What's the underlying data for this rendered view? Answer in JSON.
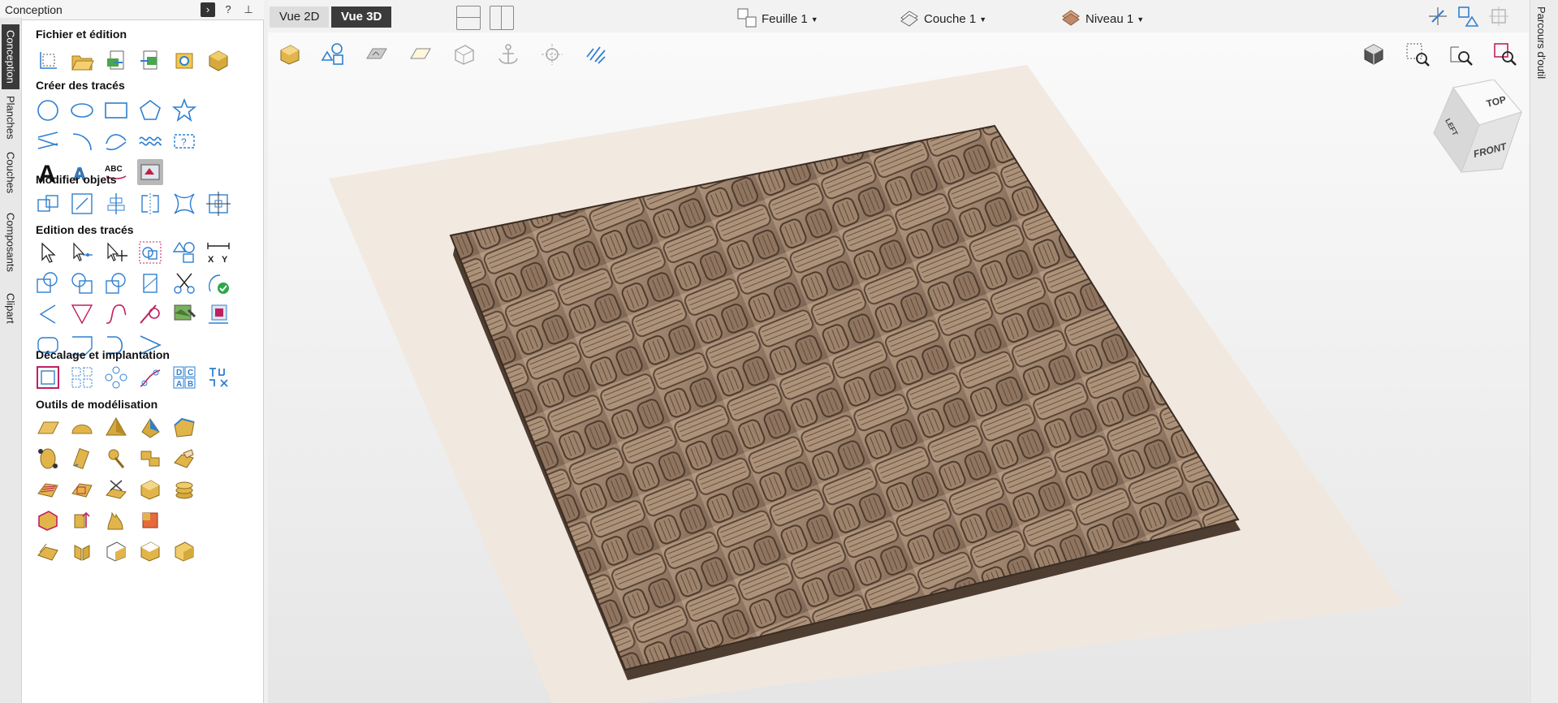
{
  "panel": {
    "title": "Conception",
    "help": "?",
    "pin": "⊥"
  },
  "side_tabs": [
    "Conception",
    "Planches",
    "Couches",
    "Composants",
    "Clipart"
  ],
  "sections": {
    "file": "Fichier et édition",
    "create": "Créer des tracés",
    "modify": "Modifier objets",
    "edit": "Edition des tracés",
    "offset": "Décalage et implantation",
    "modeling": "Outils de modélisation"
  },
  "create_text_glyphs": {
    "big_a": "A",
    "abc": "ABC"
  },
  "edit_xy": {
    "x": "X",
    "y": "Y"
  },
  "offset_labels": {
    "a": "A",
    "b": "B",
    "c": "C",
    "d": "D"
  },
  "toolbar": {
    "vue2d": "Vue 2D",
    "vue3d": "Vue 3D",
    "sheet": "Feuille 1",
    "layer": "Couche 1",
    "level": "Niveau 1"
  },
  "viewcube": {
    "top": "TOP",
    "left": "LEFT",
    "front": "FRONT"
  },
  "right_tab": "Parcours d'outil",
  "colors": {
    "accent": "#2f7fd1",
    "gold": "#e2b54a",
    "model": "#9c826c"
  }
}
